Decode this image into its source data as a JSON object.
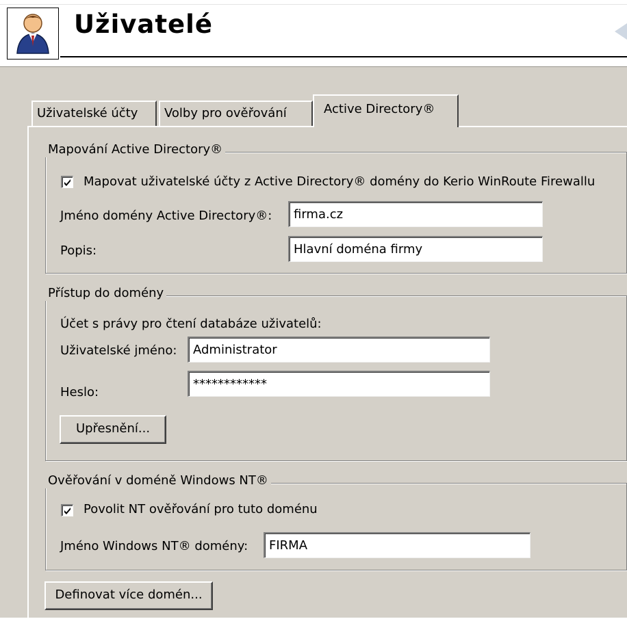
{
  "header": {
    "title": "Uživatelé",
    "icon": "users-icon"
  },
  "tabs": [
    {
      "label": "Uživatelské účty",
      "active": false
    },
    {
      "label": "Volby pro ověřování",
      "active": false
    },
    {
      "label": "Active Directory®",
      "active": true
    }
  ],
  "ad_mapping": {
    "legend": "Mapování Active Directory®",
    "map_checkbox_label": "Mapovat uživatelské účty z Active Directory® domény do Kerio WinRoute Firewallu",
    "map_checked": true,
    "domain_label": "Jméno domény Active Directory®:",
    "domain_value": "firma.cz",
    "desc_label": "Popis:",
    "desc_value": "Hlavní doména firmy"
  },
  "domain_access": {
    "legend": "Přístup do domény",
    "info": "Účet s právy pro čtení databáze uživatelů:",
    "username_label": "Uživatelské jméno:",
    "username_value": "Administrator",
    "password_label": "Heslo:",
    "password_value": "************",
    "advanced_button": "Upřesnění..."
  },
  "nt_auth": {
    "legend": "Ověřování v doméně Windows NT®",
    "enable_label": "Povolit NT ověřování pro tuto doménu",
    "enable_checked": true,
    "nt_domain_label": "Jméno Windows NT® domény:",
    "nt_domain_value": "FIRMA"
  },
  "more_domains_button": "Definovat více domén..."
}
